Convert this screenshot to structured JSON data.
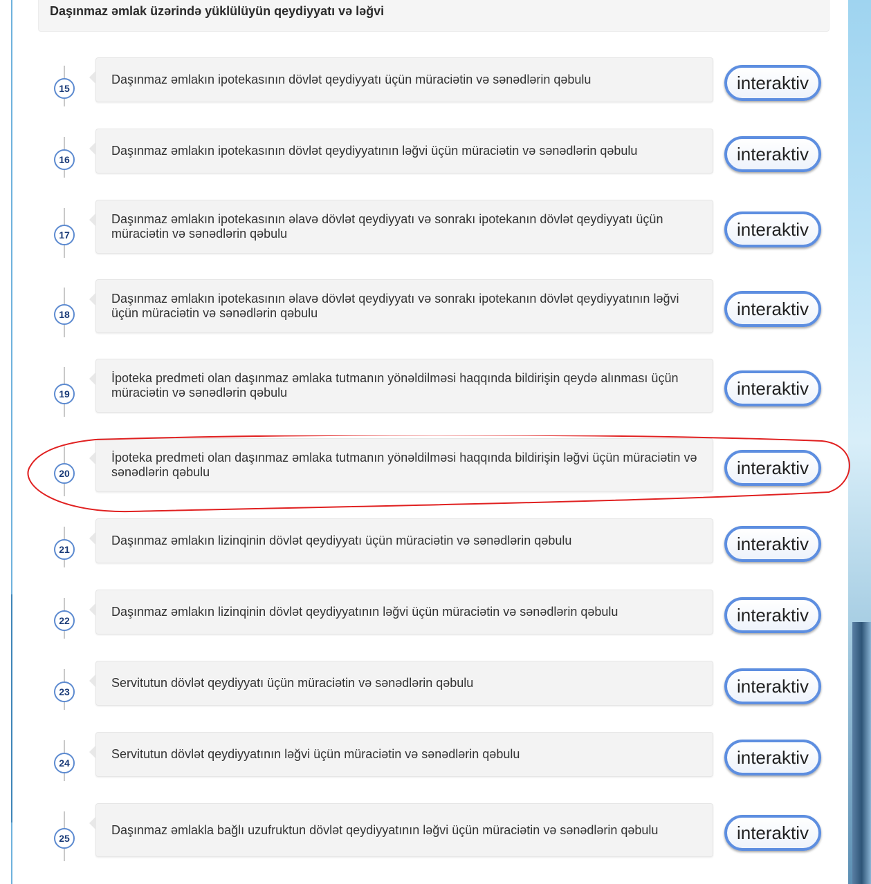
{
  "header": {
    "title": "Daşınmaz əmlak üzərində yüklülüyün qeydiyyatı və ləğvi"
  },
  "button_label": "interaktiv",
  "items": [
    {
      "num": "15",
      "text": "Daşınmaz əmlakın ipotekasının dövlət qeydiyyatı üçün müraciətin və sənədlərin qəbulu"
    },
    {
      "num": "16",
      "text": "Daşınmaz əmlakın ipotekasının dövlət qeydiyyatının ləğvi üçün müraciətin və sənədlərin qəbulu"
    },
    {
      "num": "17",
      "text": "Daşınmaz əmlakın ipotekasının əlavə dövlət qeydiyyatı və sonrakı ipotekanın dövlət qeydiyyatı üçün müraciətin və sənədlərin qəbulu"
    },
    {
      "num": "18",
      "text": "Daşınmaz əmlakın ipotekasının əlavə dövlət qeydiyyatı və sonrakı ipotekanın dövlət qeydiyyatının ləğvi üçün müraciətin və sənədlərin qəbulu"
    },
    {
      "num": "19",
      "text": "İpoteka predmeti olan daşınmaz əmlaka tutmanın yönəldilməsi haqqında bildirişin qeydə alınması üçün müraciətin və sənədlərin qəbulu"
    },
    {
      "num": "20",
      "text": "İpoteka predmeti olan daşınmaz əmlaka tutmanın yönəldilməsi haqqında bildirişin ləğvi üçün müraciətin və sənədlərin qəbulu"
    },
    {
      "num": "21",
      "text": "Daşınmaz əmlakın lizinqinin dövlət qeydiyyatı üçün müraciətin və sənədlərin qəbulu"
    },
    {
      "num": "22",
      "text": "Daşınmaz əmlakın lizinqinin dövlət qeydiyyatının ləğvi üçün müraciətin və sənədlərin qəbulu"
    },
    {
      "num": "23",
      "text": "Servitutun dövlət qeydiyyatı üçün müraciətin və sənədlərin qəbulu"
    },
    {
      "num": "24",
      "text": "Servitutun dövlət qeydiyyatının ləğvi üçün müraciətin və sənədlərin qəbulu"
    },
    {
      "num": "25",
      "text": "Daşınmaz əmlakla bağlı uzufruktun dövlət qeydiyyatının ləğvi üçün müraciətin və sənədlərin qəbulu"
    }
  ],
  "colors": {
    "accent": "#5d8ee0",
    "annotation": "#e02020"
  }
}
